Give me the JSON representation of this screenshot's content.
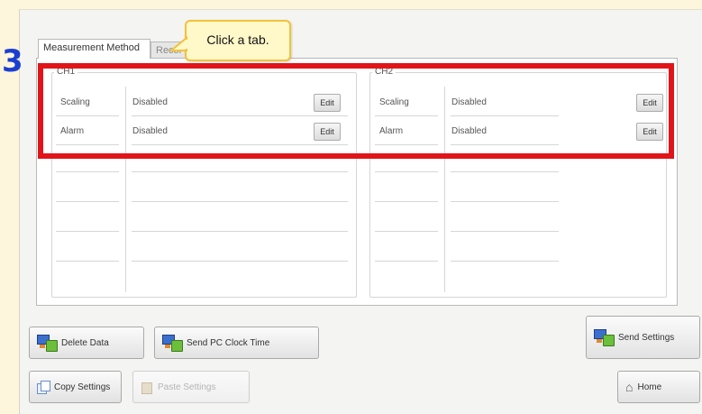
{
  "step_number": "3",
  "callout": {
    "text": "Click a tab."
  },
  "tabs": [
    {
      "label": "Measurement Method"
    },
    {
      "label": "Recor"
    }
  ],
  "ch1": {
    "title": "CH1",
    "rows": [
      {
        "label": "Scaling",
        "value": "Disabled",
        "button": "Edit"
      },
      {
        "label": "Alarm",
        "value": "Disabled",
        "button": "Edit"
      }
    ]
  },
  "ch2": {
    "title": "CH2",
    "rows": [
      {
        "label": "Scaling",
        "value": "Disabled",
        "button": "Edit"
      },
      {
        "label": "Alarm",
        "value": "Disabled",
        "button": "Edit"
      }
    ]
  },
  "buttons": {
    "delete_data": "Delete Data",
    "send_pc_clock": "Send PC Clock Time",
    "send_settings": "Send Settings",
    "copy_settings": "Copy Settings",
    "paste_settings": "Paste Settings",
    "home": "Home"
  },
  "colors": {
    "highlight": "#e0151a",
    "step_number": "#1a3fd0",
    "callout_fill": "#fff8c9",
    "callout_border": "#f2c23a"
  }
}
